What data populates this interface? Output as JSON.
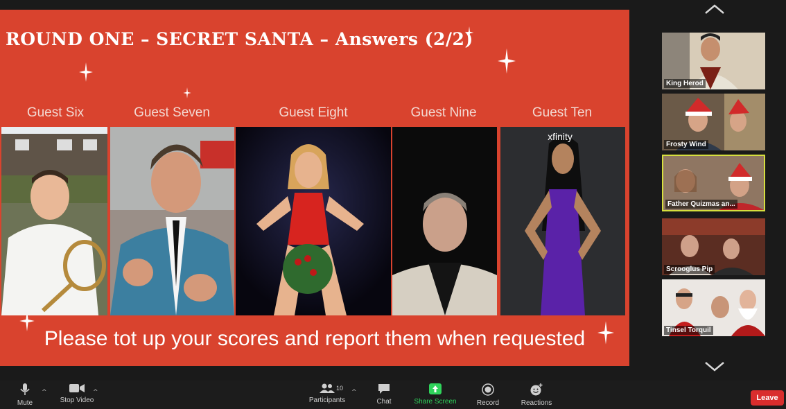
{
  "slide": {
    "title": "ROUND ONE – SECRET SANTA – Answers (2/2)",
    "guests": [
      {
        "label": "Guest Six"
      },
      {
        "label": "Guest Seven"
      },
      {
        "label": "Guest Eight"
      },
      {
        "label": "Guest Nine"
      },
      {
        "label": "Guest Ten"
      }
    ],
    "photo_text": {
      "xfinity": "xfinity"
    },
    "footer": "Please tot up your scores and report them when requested"
  },
  "gallery": {
    "participants": [
      {
        "name": "King Herod"
      },
      {
        "name": "Frosty Wind"
      },
      {
        "name": "Father Quizmas an..."
      },
      {
        "name": "Scrooglus Pip"
      },
      {
        "name": "Tinsel Torquil"
      }
    ]
  },
  "toolbar": {
    "mute": "Mute",
    "stop_video": "Stop Video",
    "participants": "Participants",
    "participants_count": "10",
    "chat": "Chat",
    "share_screen": "Share Screen",
    "record": "Record",
    "reactions": "Reactions",
    "leave": "Leave"
  },
  "colors": {
    "slide_bg": "#d9432e",
    "share_green": "#2fd35b",
    "leave_red": "#d92d2d",
    "active_border": "#d6df3e"
  }
}
